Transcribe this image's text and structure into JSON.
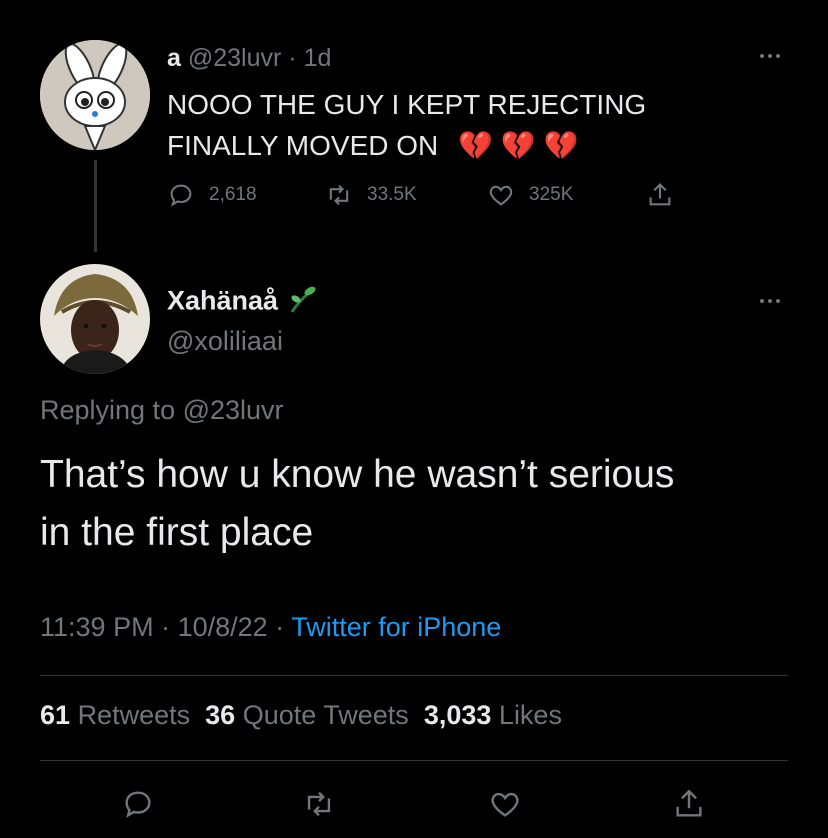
{
  "parent_tweet": {
    "display_name": "a",
    "handle": "@23luvr",
    "separator": "·",
    "age": "1d",
    "text": "NOOO THE GUY I KEPT REJECTING",
    "text_line2": "FINALLY MOVED ON",
    "emoji": "💔💔💔",
    "actions": {
      "replies": "2,618",
      "retweets": "33.5K",
      "likes": "325K"
    }
  },
  "reply_tweet": {
    "display_name": "Xahänaå",
    "name_emoji": "🌱",
    "handle": "@xoliliaai",
    "replying_prefix": "Replying to ",
    "replying_to": "@23luvr",
    "text": "That’s how u know he wasn’t serious",
    "text_line2": "in the first place",
    "time": "11:39 PM",
    "separator": " · ",
    "date": "10/8/22",
    "source_sep": " · ",
    "source": "Twitter for iPhone",
    "stats": {
      "retweets_count": "61",
      "retweets_label": "Retweets",
      "quotes_count": "36",
      "quotes_label": "Quote Tweets",
      "likes_count": "3,033",
      "likes_label": "Likes"
    }
  },
  "colors": {
    "background": "#000000",
    "text": "#e7e9ea",
    "muted": "#71767b",
    "link": "#1d9bf0",
    "divider": "#2f3336"
  },
  "icons": [
    "more-icon",
    "reply-icon",
    "retweet-icon",
    "like-icon",
    "share-icon"
  ]
}
